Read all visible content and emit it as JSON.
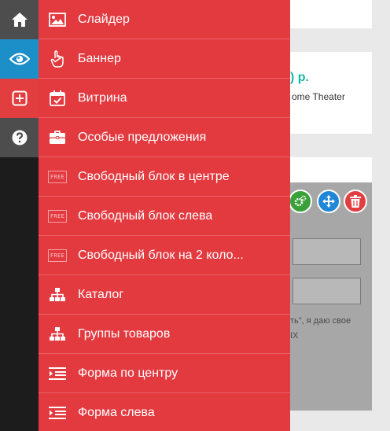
{
  "rail": {
    "items": [
      {
        "name": "home",
        "icon": "home-icon"
      },
      {
        "name": "view",
        "icon": "eye-icon"
      },
      {
        "name": "add",
        "icon": "plus-square-icon"
      },
      {
        "name": "help",
        "icon": "question-icon"
      }
    ]
  },
  "menu": {
    "items": [
      {
        "label": "Слайдер",
        "icon": "image-icon"
      },
      {
        "label": "Баннер",
        "icon": "pointer-hand-icon"
      },
      {
        "label": "Витрина",
        "icon": "calendar-check-icon"
      },
      {
        "label": "Особые предложения",
        "icon": "briefcase-icon"
      },
      {
        "label": "Свободный блок в центре",
        "icon": "free-badge-icon"
      },
      {
        "label": "Свободный блок слева",
        "icon": "free-badge-icon"
      },
      {
        "label": "Свободный блок на 2 коло...",
        "icon": "free-badge-icon"
      },
      {
        "label": "Каталог",
        "icon": "sitemap-icon"
      },
      {
        "label": "Группы товаров",
        "icon": "sitemap-icon"
      },
      {
        "label": "Форма по центру",
        "icon": "form-list-icon"
      },
      {
        "label": "Форма слева",
        "icon": "form-list-icon"
      }
    ],
    "free_badge": "FREE"
  },
  "background": {
    "price_text": ") р.",
    "product_text": "ome Theater",
    "panel_line1": "ть\", я даю свое",
    "panel_line2": "IX"
  },
  "colors": {
    "menu_bg": "#e33a40",
    "rail_bg": "#1c1c1c",
    "rail_active": "#1c8fc9",
    "rail_add": "#e23d3f",
    "price": "#1bb7a2"
  }
}
